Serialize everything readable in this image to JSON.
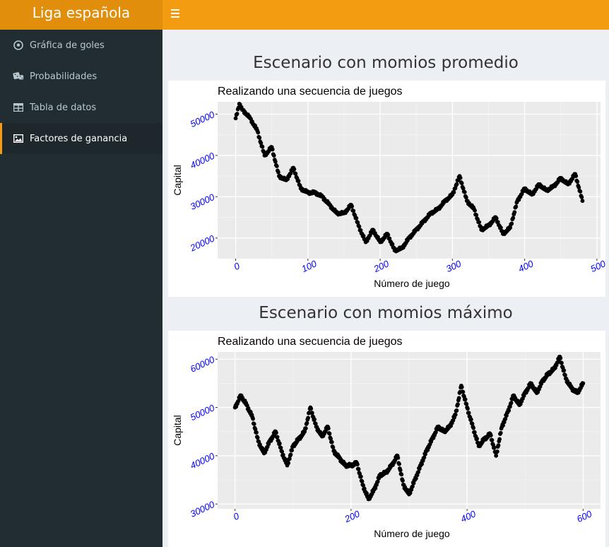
{
  "app": {
    "title": "Liga española"
  },
  "sidebar": {
    "items": [
      {
        "label": "Gráfica de goles",
        "icon": "soccer-ball-icon",
        "active": false
      },
      {
        "label": "Probabilidades",
        "icon": "dice-icon",
        "active": false
      },
      {
        "label": "Tabla de datos",
        "icon": "table-icon",
        "active": false
      },
      {
        "label": "Factores de ganancia",
        "icon": "image-icon",
        "active": true
      }
    ]
  },
  "sections": [
    {
      "heading": "Escenario con momios promedio"
    },
    {
      "heading": "Escenario con momios máximo"
    }
  ],
  "colors": {
    "header": "#f39c12",
    "brand": "#e08e0b",
    "sidebar": "#222d32",
    "accent": "#f39c12",
    "tick_label": "#0000ff",
    "panel": "#ebebeb",
    "points": "#000000"
  },
  "chart_data": [
    {
      "type": "scatter",
      "title": "Realizando una secuencia de juegos",
      "xlabel": "Número de juego",
      "ylabel": "Capital",
      "xlim": [
        -25,
        505
      ],
      "ylim": [
        15000,
        53000
      ],
      "xticks": [
        "0",
        "100",
        "200",
        "300",
        "400",
        "500"
      ],
      "yticks": [
        "20000",
        "30000",
        "40000",
        "50000"
      ],
      "grid": true,
      "series": [
        {
          "x": [
            0,
            5,
            10,
            20,
            30,
            40,
            50,
            60,
            70,
            80,
            90,
            100,
            110,
            120,
            130,
            140,
            150,
            160,
            170,
            180,
            190,
            200,
            210,
            220,
            230,
            240,
            250,
            260,
            270,
            280,
            290,
            300,
            310,
            320,
            330,
            340,
            350,
            360,
            370,
            380,
            390,
            400,
            410,
            420,
            430,
            440,
            450,
            460,
            470,
            480
          ],
          "y": [
            49000,
            52500,
            51000,
            49000,
            46000,
            40000,
            42000,
            35000,
            34000,
            37000,
            32000,
            31000,
            31000,
            30000,
            28000,
            26000,
            26000,
            28000,
            23000,
            19000,
            22000,
            19000,
            21000,
            17000,
            17500,
            20000,
            22000,
            24000,
            26000,
            27000,
            29000,
            30500,
            35000,
            29000,
            27000,
            22000,
            23000,
            25000,
            21000,
            22500,
            29000,
            32000,
            30500,
            33000,
            31500,
            32500,
            34500,
            33000,
            35500,
            29000
          ]
        }
      ]
    },
    {
      "type": "scatter",
      "title": "Realizando una secuencia de juegos",
      "xlabel": "Número de juego",
      "ylabel": "Capital",
      "xlim": [
        -30,
        630
      ],
      "ylim": [
        29000,
        61500
      ],
      "xticks": [
        "0",
        "200",
        "400",
        "600"
      ],
      "yticks": [
        "30000",
        "40000",
        "50000",
        "60000"
      ],
      "grid": true,
      "series": [
        {
          "x": [
            0,
            10,
            20,
            30,
            40,
            50,
            60,
            70,
            80,
            90,
            100,
            110,
            120,
            130,
            140,
            150,
            160,
            170,
            180,
            190,
            200,
            210,
            220,
            230,
            240,
            250,
            260,
            270,
            280,
            290,
            300,
            310,
            320,
            330,
            340,
            350,
            360,
            370,
            380,
            390,
            400,
            410,
            420,
            430,
            440,
            450,
            460,
            470,
            480,
            490,
            500,
            510,
            520,
            530,
            540,
            550,
            560,
            570,
            580,
            590,
            600
          ],
          "y": [
            50000,
            52500,
            50500,
            48000,
            43000,
            40500,
            43000,
            45000,
            41000,
            38000,
            42000,
            43500,
            45000,
            50000,
            46000,
            44000,
            46000,
            41000,
            39500,
            38000,
            38000,
            38500,
            34000,
            31000,
            33000,
            36000,
            36500,
            38000,
            40000,
            34000,
            32000,
            35000,
            38000,
            41000,
            43500,
            46000,
            45000,
            46000,
            48500,
            54500,
            50000,
            46000,
            42000,
            43500,
            44500,
            40000,
            46000,
            49000,
            52500,
            50500,
            53000,
            55000,
            53000,
            55500,
            57000,
            58000,
            60500,
            56000,
            54000,
            53000,
            55000
          ]
        }
      ]
    }
  ]
}
